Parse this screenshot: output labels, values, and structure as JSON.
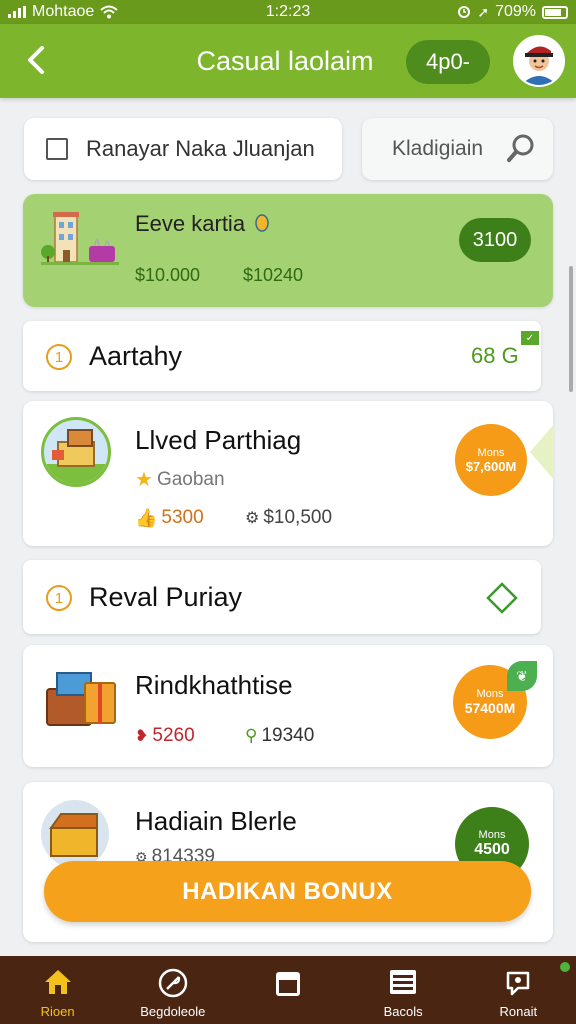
{
  "status_bar": {
    "carrier": "Mohtaoe",
    "time": "1:2:23",
    "battery": "709%"
  },
  "header": {
    "title": "Casual laolaim",
    "coins": "4p0-"
  },
  "search": {
    "placeholder": "Ranayar Naka Jluanjan",
    "secondary": "Kladigiain"
  },
  "banner": {
    "title": "Eeve kartia",
    "value1": "$10.000",
    "value2": "$10240",
    "pill": "3100"
  },
  "section1": {
    "index": "1",
    "title": "Aartahy",
    "right_value": "68 G"
  },
  "card1": {
    "name": "Llved Parthiag",
    "sub": "Gaoban",
    "stat1": "5300",
    "stat2": "$10,500",
    "badge_top": "Mons",
    "badge_value": "$7,600M"
  },
  "section2": {
    "index": "1",
    "title": "Reval Puriay"
  },
  "card2": {
    "name": "Rindkhathtise",
    "stat1": "5260",
    "stat2": "19340",
    "badge_top": "Mons",
    "badge_value": "57400M"
  },
  "card3": {
    "name": "Hadiain Blerle",
    "stat1": "814339",
    "badge_top": "Mons",
    "badge_value": "4500"
  },
  "bonus_button": "HADIKAN BONUX",
  "tabs": [
    {
      "label": "Rioen",
      "icon": "home-icon"
    },
    {
      "label": "Begdoleole",
      "icon": "leaf-icon"
    },
    {
      "label": "",
      "icon": "box-icon"
    },
    {
      "label": "Bacols",
      "icon": "list-icon"
    },
    {
      "label": "Ronait",
      "icon": "profile-icon"
    }
  ],
  "colors": {
    "primary": "#7db62c",
    "accent": "#f6a11c",
    "dark_green": "#3d7f19",
    "tabbar": "#4a2511"
  }
}
